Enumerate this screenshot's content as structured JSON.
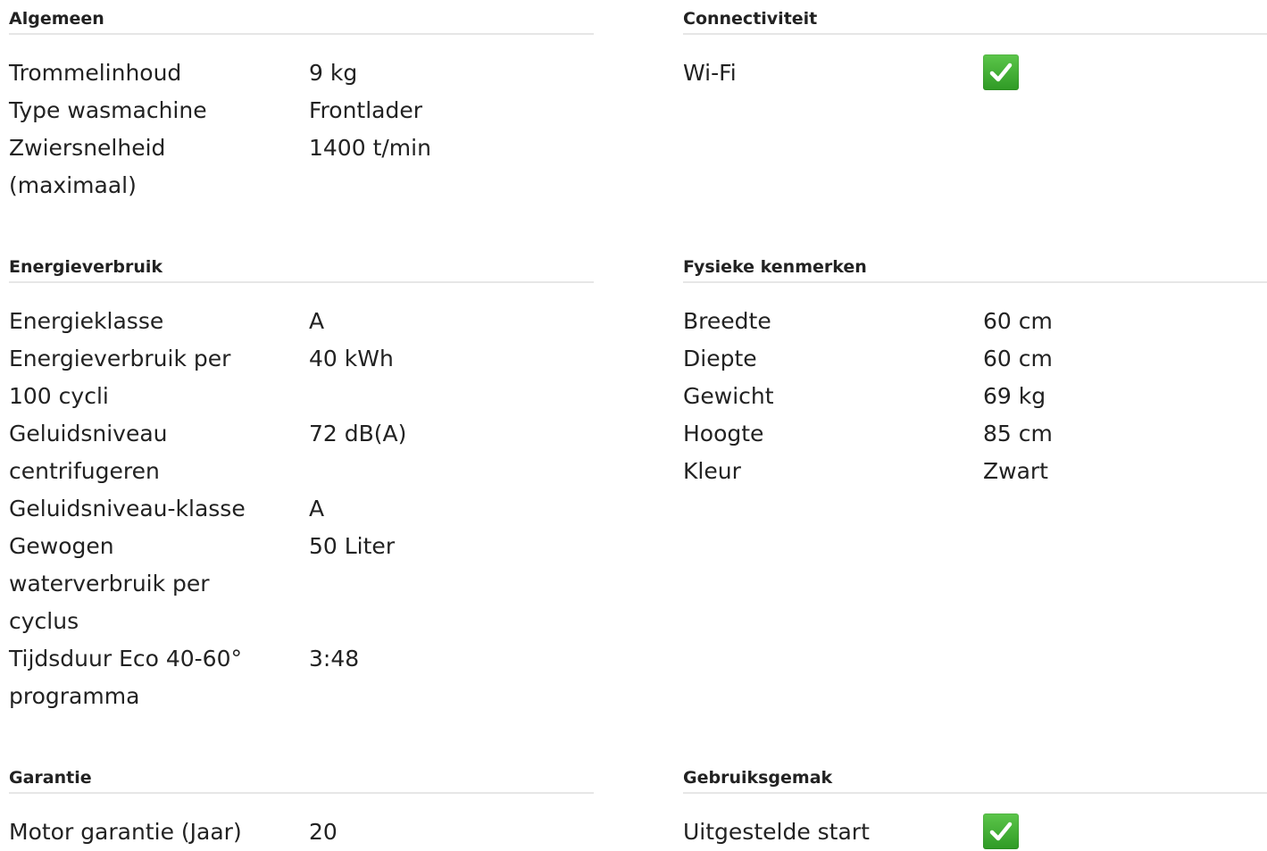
{
  "sections": {
    "algemeen": {
      "title": "Algemeen",
      "rows": [
        {
          "label": "Trommelinhoud",
          "value": "9 kg"
        },
        {
          "label": "Type wasmachine",
          "value": "Frontlader"
        },
        {
          "label": "Zwiersnelheid (maximaal)",
          "value": "1400 t/min"
        }
      ]
    },
    "connectiviteit": {
      "title": "Connectiviteit",
      "rows": [
        {
          "label": "Wi-Fi",
          "value_icon": "check-icon"
        }
      ]
    },
    "energieverbruik": {
      "title": "Energieverbruik",
      "rows": [
        {
          "label": "Energieklasse",
          "value": "A"
        },
        {
          "label": "Energieverbruik per 100 cycli",
          "value": "40 kWh"
        },
        {
          "label": "Geluidsniveau centrifugeren",
          "value": "72 dB(A)"
        },
        {
          "label": "Geluidsniveau-klasse",
          "value": "A"
        },
        {
          "label": "Gewogen waterverbruik per cyclus",
          "value": "50 Liter"
        },
        {
          "label": "Tijdsduur Eco 40-60° programma",
          "value": "3:48"
        }
      ]
    },
    "fysieke": {
      "title": "Fysieke kenmerken",
      "rows": [
        {
          "label": "Breedte",
          "value": "60 cm"
        },
        {
          "label": "Diepte",
          "value": "60 cm"
        },
        {
          "label": "Gewicht",
          "value": "69 kg"
        },
        {
          "label": "Hoogte",
          "value": "85 cm"
        },
        {
          "label": "Kleur",
          "value": "Zwart"
        }
      ]
    },
    "garantie": {
      "title": "Garantie",
      "rows": [
        {
          "label": "Motor garantie (Jaar)",
          "value": "20"
        }
      ]
    },
    "gebruiksgemak": {
      "title": "Gebruiksgemak",
      "rows": [
        {
          "label": "Uitgestelde start",
          "value_icon": "check-icon"
        }
      ]
    }
  },
  "colors": {
    "check_green": "#3aa82e",
    "divider": "#e6e6e6",
    "text": "#222222"
  }
}
